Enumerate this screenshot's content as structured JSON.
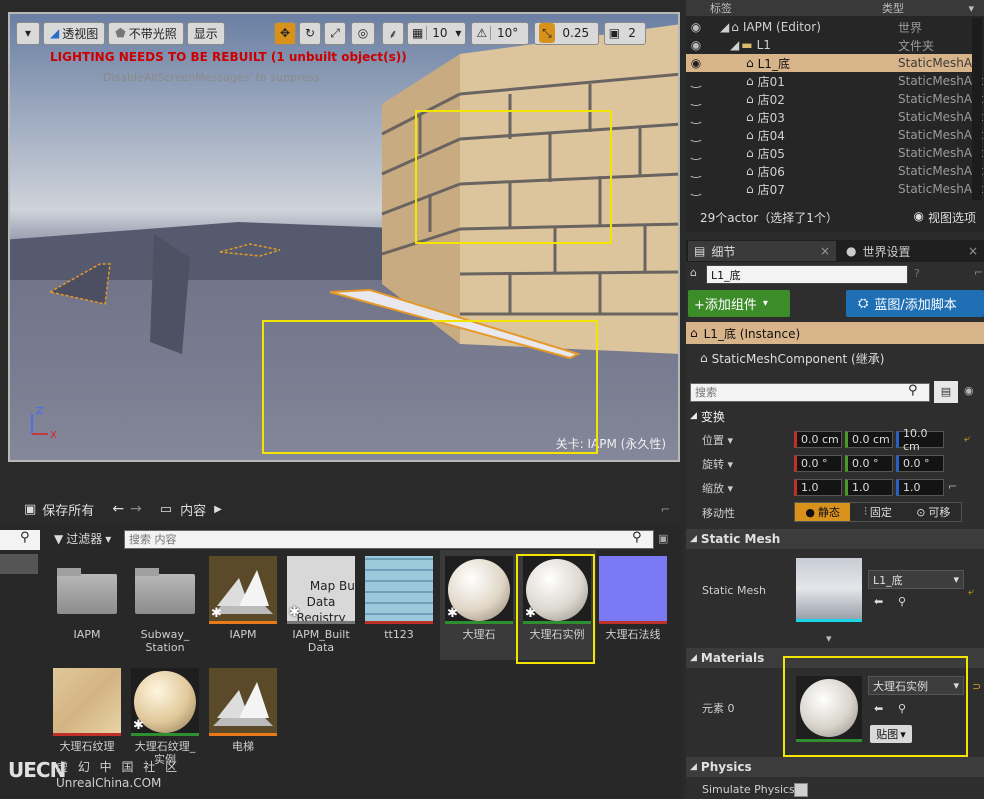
{
  "viewport": {
    "dropdown_icon": "chevron-down-icon",
    "perspective": "透视图",
    "lighting": "不带光照",
    "show": "显示",
    "grid_value": "10",
    "angle_value": "10°",
    "scale_value": "0.25",
    "speed_value": "2",
    "warning": "LIGHTING NEEDS TO BE REBUILT (1 unbuilt object(s))",
    "suppress": "'DisableAllScreenMessages' to suppress",
    "level": "关卡: IAPM (永久性)",
    "warning_color": "#cc0000"
  },
  "outliner": {
    "col_label": "标签",
    "col_type": "类型",
    "rows": [
      {
        "label": "IAPM (Editor)",
        "type": "世界"
      },
      {
        "label": "L1",
        "type": "文件夹"
      },
      {
        "label": "L1_底",
        "type": "StaticMeshAct"
      },
      {
        "label": "店01",
        "type": "StaticMeshAct"
      },
      {
        "label": "店02",
        "type": "StaticMeshAct"
      },
      {
        "label": "店03",
        "type": "StaticMeshAct"
      },
      {
        "label": "店04",
        "type": "StaticMeshAct"
      },
      {
        "label": "店05",
        "type": "StaticMeshAct"
      },
      {
        "label": "店06",
        "type": "StaticMeshAct"
      },
      {
        "label": "店07",
        "type": "StaticMeshAct"
      }
    ],
    "status": "29个actor（选择了1个）",
    "view_options": "视图选项"
  },
  "details": {
    "tab_details": "细节",
    "tab_world": "世界设置",
    "name": "L1_底",
    "add_component": "+添加组件",
    "blueprint": "蓝图/添加脚本",
    "instance": "L1_底 (Instance)",
    "component": "StaticMeshComponent (继承)",
    "search_placeholder": "搜索",
    "transform": "变换",
    "location": "位置",
    "rotation": "旋转",
    "scale": "缩放",
    "mobility": "移动性",
    "loc": [
      "0.0 cm",
      "0.0 cm",
      "10.0 cm"
    ],
    "rot": [
      "0.0 °",
      "0.0 °",
      "0.0 °"
    ],
    "scl": [
      "1.0",
      "1.0",
      "1.0"
    ],
    "mob_static": "静态",
    "mob_fixed": "固定",
    "mob_movable": "可移",
    "sm_section": "Static Mesh",
    "sm_label": "Static Mesh",
    "sm_value": "L1_底",
    "mat_section": "Materials",
    "element0": "元素 0",
    "mat_value": "大理石实例",
    "texture_btn": "贴图",
    "phys_section": "Physics",
    "simulate": "Simulate Physics",
    "accent": "#2f8f2f"
  },
  "content": {
    "save_all": "保存所有",
    "path": "内容",
    "filter": "过滤器",
    "search_placeholder": "搜索 内容",
    "assets": [
      {
        "label": "IAPM"
      },
      {
        "label": "Subway_\nStation"
      },
      {
        "label": "IAPM"
      },
      {
        "label": "IAPM_Built\nData",
        "thumb_text": "Map Build\nData\nRegistry"
      },
      {
        "label": "tt123"
      },
      {
        "label": "大理石"
      },
      {
        "label": "大理石实例"
      },
      {
        "label": "大理石法线"
      },
      {
        "label": "大理石纹理"
      },
      {
        "label": "大理石纹理_\n实例"
      },
      {
        "label": "电梯"
      }
    ],
    "watermark_logo": "UECN",
    "watermark_cn": "虚 幻 中 国 社 区",
    "watermark_url": "UnrealChina.COM"
  }
}
